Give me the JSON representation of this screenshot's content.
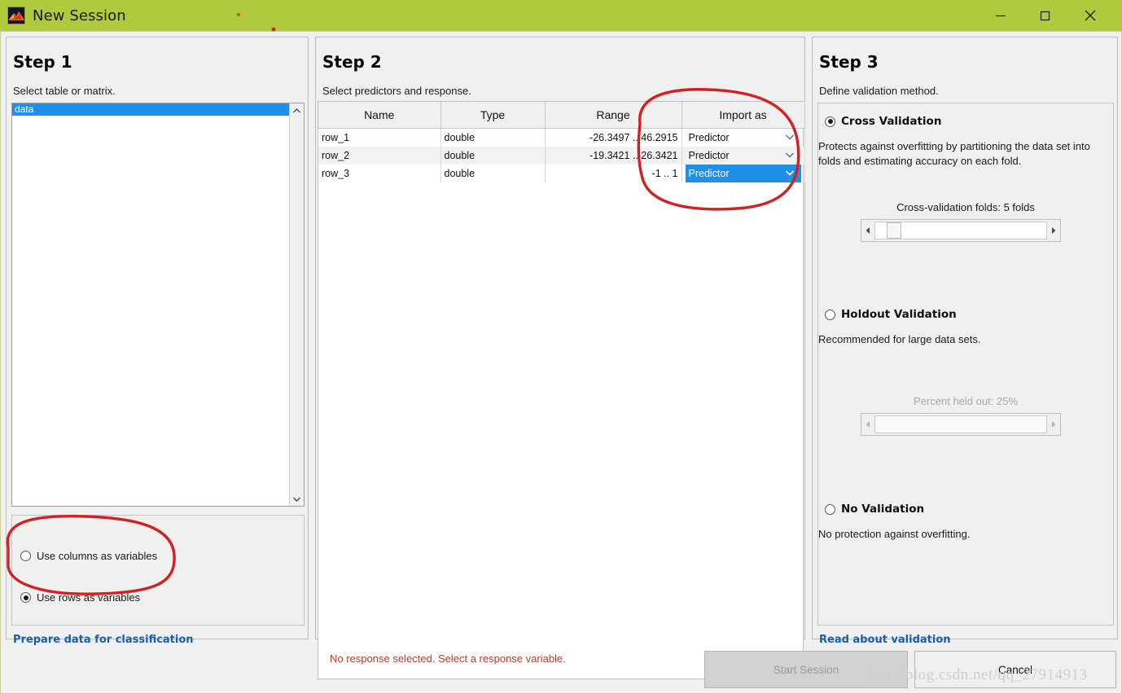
{
  "window": {
    "title": "New Session",
    "icon": "matlab-membrane-icon",
    "titlebar_color": "#afca3c",
    "controls": {
      "minimize": "minimize-icon",
      "maximize": "maximize-icon",
      "close": "close-icon"
    }
  },
  "step1": {
    "title": "Step 1",
    "subtitle": "Select table or matrix.",
    "variables": [
      {
        "name": "data",
        "selected": true
      }
    ],
    "orientation_options": [
      {
        "label": "Use columns as variables",
        "selected": false
      },
      {
        "label": "Use rows as variables",
        "selected": true
      }
    ],
    "link": "Prepare data for classification"
  },
  "step2": {
    "title": "Step 2",
    "subtitle": "Select predictors and response.",
    "columns": [
      "Name",
      "Type",
      "Range",
      "Import as"
    ],
    "rows": [
      {
        "name": "row_1",
        "type": "double",
        "range": "-26.3497 .. 46.2915",
        "import_as": "Predictor",
        "selected": false
      },
      {
        "name": "row_2",
        "type": "double",
        "range": "-19.3421 .. 26.3421",
        "import_as": "Predictor",
        "selected": false
      },
      {
        "name": "row_3",
        "type": "double",
        "range": "-1 .. 1",
        "import_as": "Predictor",
        "selected": true
      }
    ]
  },
  "step3": {
    "title": "Step 3",
    "subtitle": "Define validation method.",
    "cross_validation": {
      "label": "Cross Validation",
      "selected": true,
      "description": "Protects against overfitting by partitioning the data set into folds and estimating accuracy on each fold.",
      "slider_label": "Cross-validation folds: 5 folds",
      "folds": 5,
      "enabled": true
    },
    "holdout_validation": {
      "label": "Holdout Validation",
      "selected": false,
      "description": "Recommended for large data sets.",
      "slider_label": "Percent held out: 25%",
      "percent": 25,
      "enabled": false
    },
    "no_validation": {
      "label": "No Validation",
      "selected": false,
      "description": "No protection against overfitting."
    },
    "link": "Read about validation"
  },
  "footer": {
    "status_message": "No response selected. Select a response variable.",
    "status_color": "#c0392b",
    "start_button": "Start Session",
    "start_enabled": false,
    "cancel_button": "Cancel"
  },
  "watermark": {
    "text": "http://blog.csdn.net/qq_27914913"
  }
}
